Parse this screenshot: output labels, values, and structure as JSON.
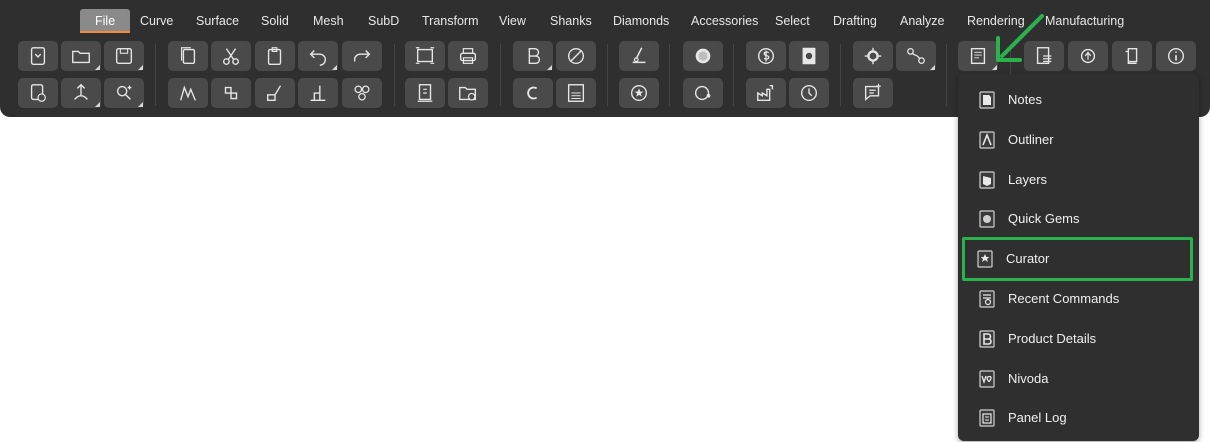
{
  "tabs": [
    {
      "label": "File",
      "active": true
    },
    {
      "label": "Curve"
    },
    {
      "label": "Surface"
    },
    {
      "label": "Solid"
    },
    {
      "label": "Mesh"
    },
    {
      "label": "SubD"
    },
    {
      "label": "Transform"
    },
    {
      "label": "View"
    },
    {
      "label": "Shanks"
    },
    {
      "label": "Diamonds"
    },
    {
      "label": "Accessories"
    },
    {
      "label": "Select"
    },
    {
      "label": "Drafting"
    },
    {
      "label": "Analyze"
    },
    {
      "label": "Rendering"
    },
    {
      "label": "Manufacturing"
    }
  ],
  "toolbar": {
    "icons": [
      "new-document-icon",
      "open-folder-icon",
      "save-icon",
      "document-clock-icon",
      "import-icon",
      "magic-select-icon",
      "copy-icon",
      "cut-icon",
      "paste-icon",
      "undo-icon",
      "redo-icon",
      "curves-icon",
      "group-icon",
      "split-icon",
      "stack-icon",
      "cluster-icon",
      "capture-icon",
      "print-icon",
      "document-export-icon",
      "folder-user-icon",
      "bold-b-icon",
      "blocked-icon",
      "copyright-icon",
      "tax-icon",
      "pen-icon",
      "star-circle-icon",
      "sphere-icon",
      "ring-icon",
      "dollar-icon",
      "dollar-film-icon",
      "factory-icon",
      "clock-icon",
      "node-icon",
      "path-icon",
      "comment-add-icon",
      "panels-icon",
      "properties-icon",
      "sync-icon",
      "box-icon",
      "info-icon"
    ]
  },
  "menu": {
    "items": [
      {
        "label": "Notes",
        "icon": "notes-icon"
      },
      {
        "label": "Outliner",
        "icon": "outliner-icon"
      },
      {
        "label": "Layers",
        "icon": "layers-icon"
      },
      {
        "label": "Quick Gems",
        "icon": "quick-gems-icon"
      },
      {
        "label": "Curator",
        "icon": "curator-icon",
        "highlighted": true
      },
      {
        "label": "Recent Commands",
        "icon": "recent-commands-icon"
      },
      {
        "label": "Product Details",
        "icon": "product-details-icon"
      },
      {
        "label": "Nivoda",
        "icon": "nivoda-icon"
      },
      {
        "label": "Panel Log",
        "icon": "panel-log-icon"
      }
    ]
  },
  "colors": {
    "ribbon_bg": "#2f2f2f",
    "button_bg": "#4a4a4a",
    "active_tab_bg": "#8a8a8a",
    "active_tab_underline": "#f08a3c",
    "highlight_green": "#2bb24c"
  }
}
